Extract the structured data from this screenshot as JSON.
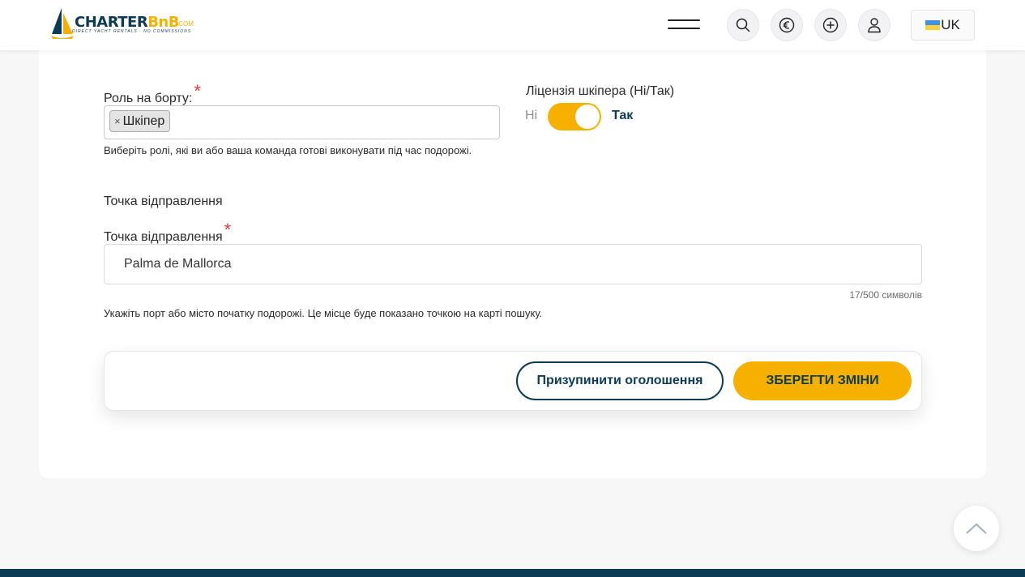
{
  "header": {
    "logo": {
      "name_part1": "CHARTER",
      "name_part2": "BnB",
      "domain": ".COM",
      "tagline": "DIRECT YACHT RENTALS · NO COMMISSIONS"
    },
    "icons": [
      "menu-icon",
      "search-icon",
      "euro-icon",
      "plus-circle-icon",
      "user-icon"
    ],
    "language": "UK",
    "colors": {
      "brand_navy": "#0c3b55",
      "brand_yellow": "#f6b100"
    }
  },
  "form": {
    "role": {
      "label": "Роль на борту:",
      "required_mark": "*",
      "selected_tags": [
        {
          "remove": "×",
          "label": "Шкіпер"
        }
      ],
      "help": "Виберіть ролі, які ви або ваша команда готові виконувати під час подорожі."
    },
    "license": {
      "label": "Ліцензія шкіпера (Ні/Так)",
      "off_label": "Ні",
      "on_label": "Так",
      "checked": true
    },
    "departure": {
      "section_title": "Точка відправлення",
      "label": "Точка відправлення",
      "required_mark": "*",
      "value": "Palma de Mallorca",
      "counter": "17/500 символів",
      "help": "Укажіть порт або місто початку подорожі. Це місце буде показано точкою на карті пошуку."
    }
  },
  "actions": {
    "pause_label": "Призупинити оголошення",
    "save_label": "ЗБЕРЕГТИ ЗМІНИ"
  },
  "scroll_top_icon": "chevron-up-icon"
}
